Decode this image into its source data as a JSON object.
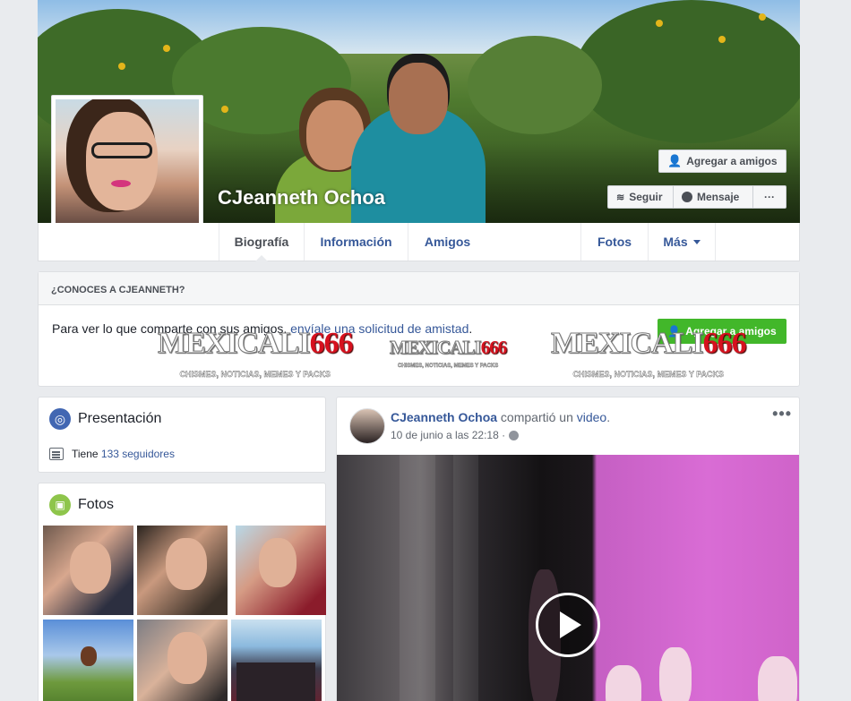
{
  "profile": {
    "name": "CJeanneth Ochoa"
  },
  "cover_actions": {
    "add_friend": "Agregar a amigos",
    "follow": "Seguir",
    "message": "Mensaje",
    "more": "···"
  },
  "nav": {
    "tabs": [
      {
        "label": "Biografía"
      },
      {
        "label": "Información"
      },
      {
        "label": "Amigos"
      },
      {
        "label": "Fotos"
      },
      {
        "label": "Más"
      }
    ]
  },
  "know_card": {
    "heading": "¿CONOCES A CJEANNETH?",
    "text_before": "Para ver lo que comparte con sus amigos, ",
    "text_link": "envíale una solicitud de amistad",
    "text_after": ".",
    "button": "Agregar a amigos"
  },
  "watermark": {
    "brand_a": "MEXICALI",
    "brand_b": "666",
    "tagline": "CHISMES, NOTICIAS, MEMES Y PACKS"
  },
  "intro": {
    "title": "Presentación",
    "followers_prefix": "Tiene ",
    "followers_link": "133 seguidores"
  },
  "photos": {
    "title": "Fotos"
  },
  "post": {
    "author": "CJeanneth Ochoa",
    "action": " compartió un ",
    "object": "video",
    "object_suffix": ".",
    "timestamp": "10 de junio a las 22:18 ·",
    "more": "•••"
  },
  "colors": {
    "link": "#365899",
    "green_button": "#42b72a",
    "page_bg": "#e9ebee"
  },
  "icons": [
    "add-friend-icon",
    "rss-icon",
    "messenger-icon",
    "caret-down-icon",
    "globe-icon",
    "list-icon",
    "photo-icon",
    "play-icon"
  ]
}
